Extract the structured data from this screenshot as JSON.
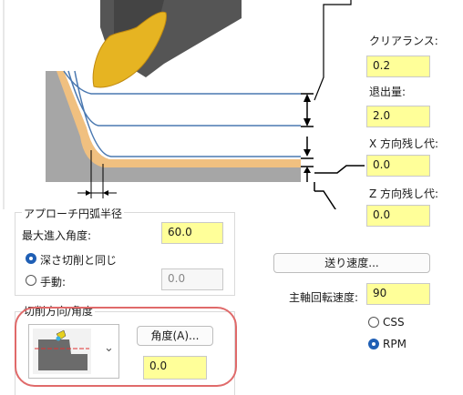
{
  "right": {
    "clearance_label": "クリアランス:",
    "clearance_value": "0.2",
    "retract_label": "退出量:",
    "retract_value": "2.0",
    "x_allow_label": "X 方向残し代:",
    "x_allow_value": "0.0",
    "z_allow_label": "Z 方向残し代:",
    "z_allow_value": "0.0",
    "feed_button": "送り速度...",
    "spindle_label": "主軸回転速度:",
    "spindle_value": "90",
    "css_label": "CSS",
    "rpm_label": "RPM"
  },
  "approach": {
    "group_title": "アプローチ円弧半径",
    "max_angle_label": "最大進入角度:",
    "max_angle_value": "60.0",
    "same_as_depth_label": "深さ切削と同じ",
    "manual_label": "手動:",
    "manual_value": "0.0"
  },
  "direction": {
    "group_title": "切削方向/角度",
    "angle_button": "角度(A)...",
    "angle_value": "0.0"
  },
  "colors": {
    "field_bg": "#ffff99",
    "tool_gold": "#e6b422",
    "stock_orange": "#f0c080",
    "path_blue": "#4a78b0",
    "highlight_red": "#e06a6a",
    "radio_blue": "#1f5fb5"
  }
}
